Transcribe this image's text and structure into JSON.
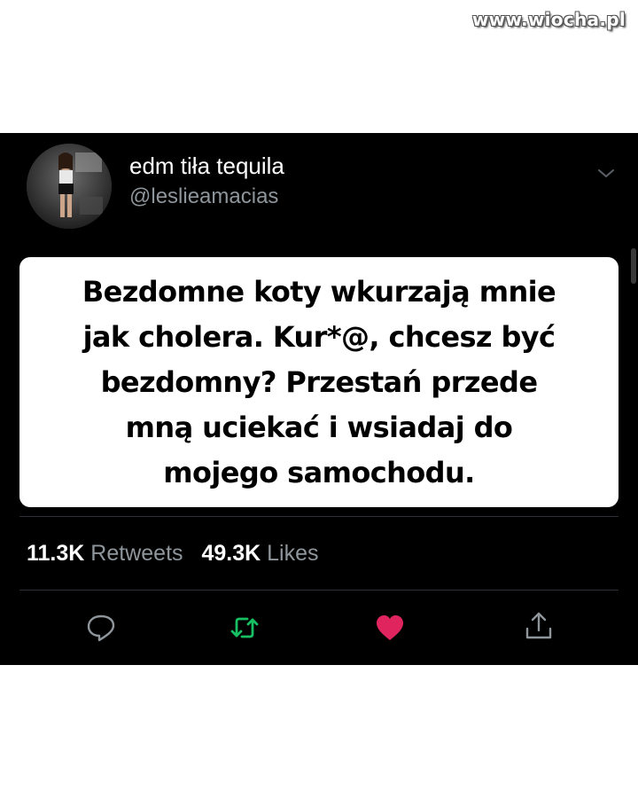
{
  "watermark": "www.wiocha.pl",
  "tweet": {
    "display_name": "edm tiła tequila",
    "handle": "@leslieamacias",
    "text": "Bezdomne koty wkurzają mnie\njak cholera. Kur*@, chcesz być\nbezdomny? Przestań przede\nmną uciekać i wsiadaj do\nmojego samochodu.",
    "retweets_count": "11.3K",
    "retweets_label": "Retweets",
    "likes_count": "49.3K",
    "likes_label": "Likes"
  },
  "icons": {
    "more": "chevron-down-icon",
    "reply": "reply-icon",
    "retweet": "retweet-icon",
    "like": "heart-icon",
    "share": "share-icon"
  },
  "colors": {
    "background": "#000000",
    "text": "#ffffff",
    "muted": "#8e959b",
    "retweet_active": "#17bf63",
    "like_active": "#e0245e"
  }
}
